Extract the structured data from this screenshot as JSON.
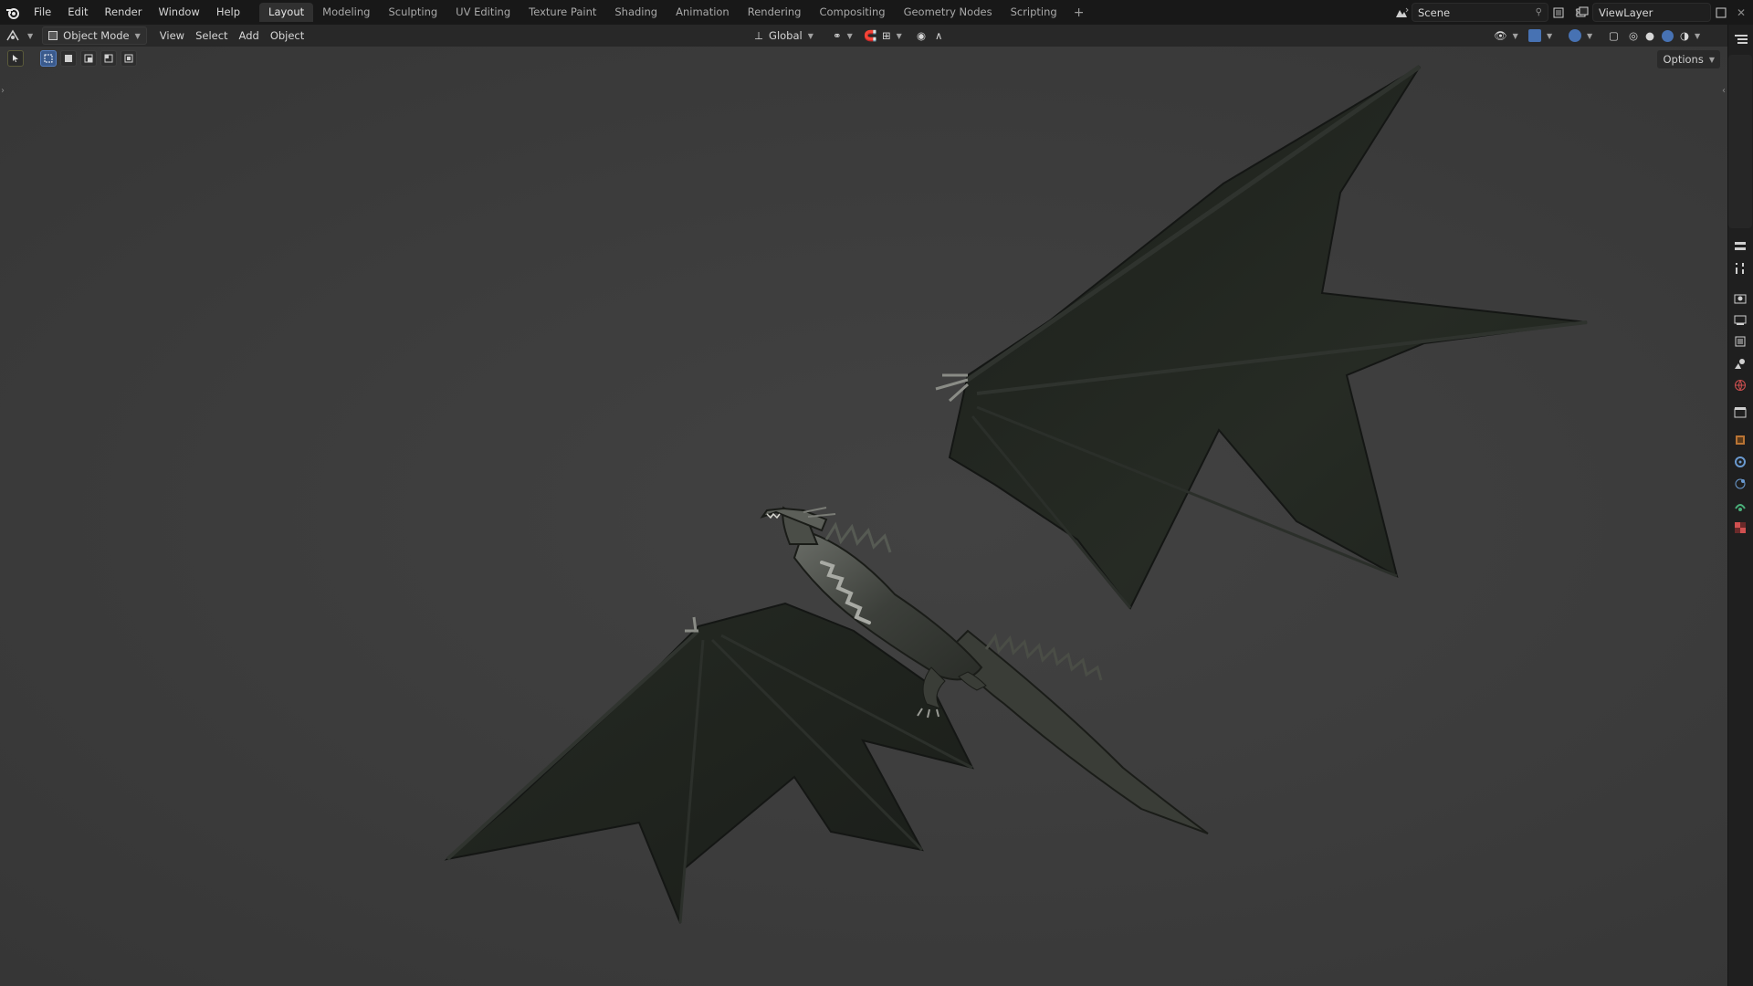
{
  "topbar": {
    "menu": [
      "File",
      "Edit",
      "Render",
      "Window",
      "Help"
    ],
    "workspaces": [
      "Layout",
      "Modeling",
      "Sculpting",
      "UV Editing",
      "Texture Paint",
      "Shading",
      "Animation",
      "Rendering",
      "Compositing",
      "Geometry Nodes",
      "Scripting"
    ],
    "active_workspace": "Layout",
    "add_tab": "+",
    "scene_name": "Scene",
    "view_layer_name": "ViewLayer"
  },
  "header": {
    "mode": "Object Mode",
    "menus": [
      "View",
      "Select",
      "Add",
      "Object"
    ],
    "transform_orientation": "Global"
  },
  "viewport": {
    "options_label": "Options",
    "object": "dragon model",
    "background_color": "#3d3d3d"
  },
  "colors": {
    "accent": "#4772b3",
    "topbar": "#181818",
    "header": "#282828"
  },
  "icons": {
    "logo": "blender-logo-icon",
    "properties": [
      "tool-icon",
      "render-icon",
      "output-icon",
      "view-layer-icon",
      "scene-icon",
      "world-icon",
      "collection-icon",
      "object-icon",
      "modifier-icon",
      "physics-icon",
      "constraint-icon",
      "data-icon",
      "texture-icon"
    ]
  }
}
